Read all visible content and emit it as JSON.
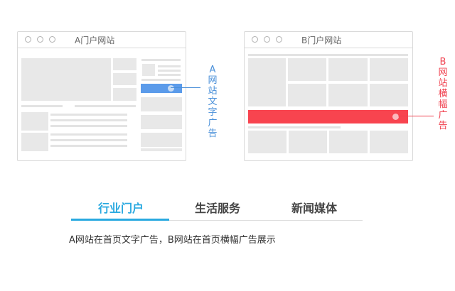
{
  "window_a": {
    "title": "A门户网站"
  },
  "window_b": {
    "title": "B门户网站"
  },
  "label_a": {
    "chars": [
      "A",
      "网",
      "站",
      "文",
      "字",
      "广",
      "告"
    ],
    "color": "#4a90d9"
  },
  "label_b": {
    "chars": [
      "B",
      "网",
      "站",
      "横",
      "幅",
      "广",
      "告"
    ],
    "color": "#f0414f"
  },
  "colors": {
    "text_ad": "#5b9bea",
    "banner_ad": "#f8444f",
    "tab_active": "#29a9e0",
    "block": "#e8e8e8"
  },
  "tabs": [
    {
      "label": "行业门户",
      "active": true
    },
    {
      "label": "生活服务",
      "active": false
    },
    {
      "label": "新闻媒体",
      "active": false
    }
  ],
  "description": "A网站在首页文字广告，B网站在首页横幅广告展示"
}
